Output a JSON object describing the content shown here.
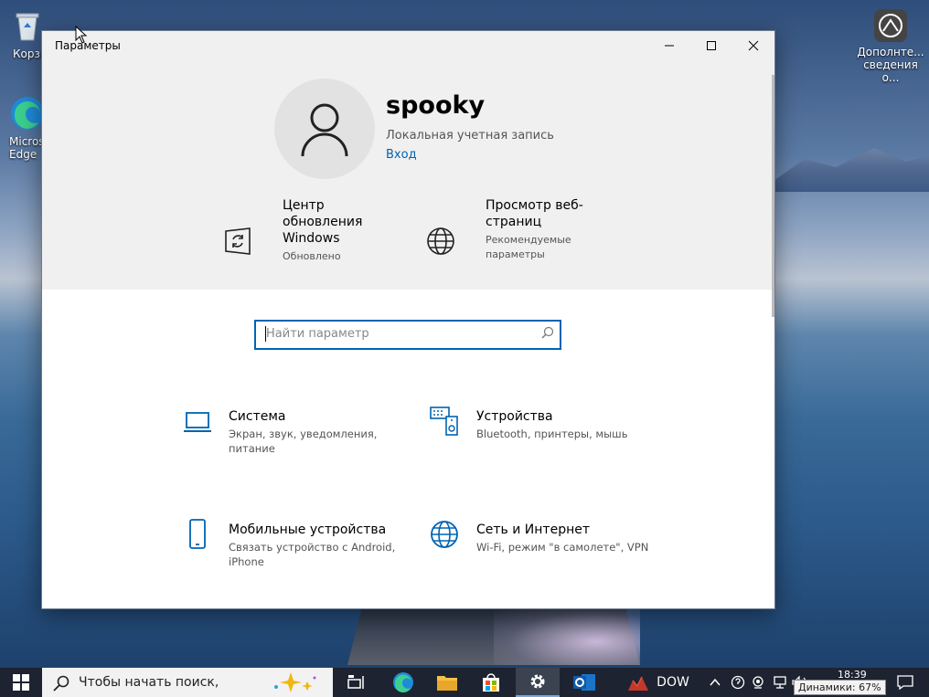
{
  "desktop": {
    "icons": [
      {
        "label": "Корзи"
      },
      {
        "label": "Micros Edge"
      },
      {
        "label": "Дополнте... сведения о..."
      }
    ]
  },
  "window": {
    "title": "Параметры"
  },
  "account": {
    "name": "spooky",
    "type": "Локальная учетная запись",
    "signin": "Вход"
  },
  "quick": [
    {
      "title": "Центр обновления Windows",
      "subtitle": "Обновлено"
    },
    {
      "title": "Просмотр веб-страниц",
      "subtitle": "Рекомендуемые параметры"
    }
  ],
  "search": {
    "placeholder": "Найти параметр"
  },
  "categories": [
    {
      "title": "Система",
      "subtitle": "Экран, звук, уведомления, питание"
    },
    {
      "title": "Устройства",
      "subtitle": "Bluetooth, принтеры, мышь"
    },
    {
      "title": "Мобильные устройства",
      "subtitle": "Связать устройство с Android, iPhone"
    },
    {
      "title": "Сеть и Интернет",
      "subtitle": "Wi-Fi, режим \"в самолете\", VPN"
    }
  ],
  "taskbar": {
    "search_placeholder": "Чтобы начать поиск,",
    "app_label": "DOW",
    "time": "18:39",
    "volume_tooltip": "Динамики: 67%"
  },
  "colors": {
    "accent": "#0063b1"
  }
}
